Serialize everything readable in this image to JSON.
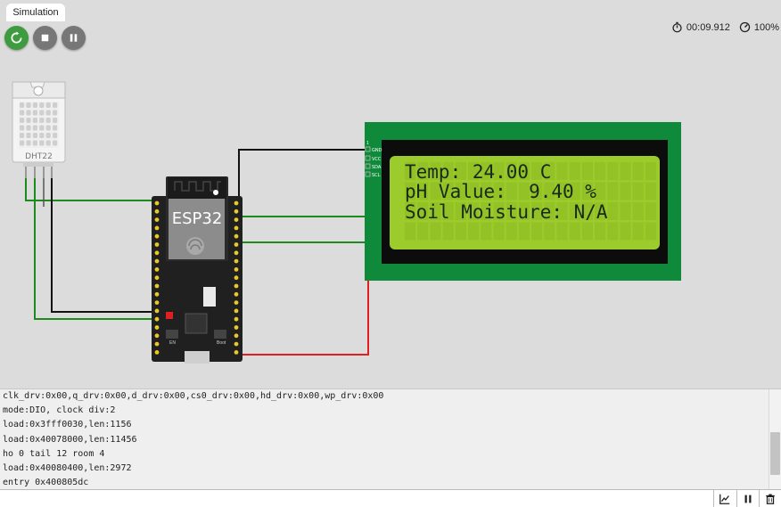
{
  "tab": {
    "label": "Simulation"
  },
  "status": {
    "elapsed": "00:09.912",
    "speed": "100%"
  },
  "dht": {
    "label": "DHT22"
  },
  "esp32": {
    "label": "ESP32"
  },
  "lcd": {
    "lines": [
      "Temp: 24.00 C",
      "pH Value:  9.40 %",
      "Soil Moisture: N/A"
    ],
    "pins": [
      "GND",
      "VCC",
      "SDA",
      "SCL"
    ],
    "pin1": "1"
  },
  "board": {
    "en_label": "EN",
    "boot_label": "Boot"
  },
  "serial": {
    "lines": [
      "clk_drv:0x00,q_drv:0x00,d_drv:0x00,cs0_drv:0x00,hd_drv:0x00,wp_drv:0x00",
      "mode:DIO, clock div:2",
      "load:0x3fff0030,len:1156",
      "load:0x40078000,len:11456",
      "ho 0 tail 12 room 4",
      "load:0x40080400,len:2972",
      "entry 0x400805dc"
    ],
    "input_value": ""
  },
  "colors": {
    "wire_green": "#1e8a1e",
    "wire_black": "#111111",
    "wire_red": "#e02020",
    "lcd_pcb": "#0f8a3a",
    "lcd_screen": "#9ccc2c"
  }
}
